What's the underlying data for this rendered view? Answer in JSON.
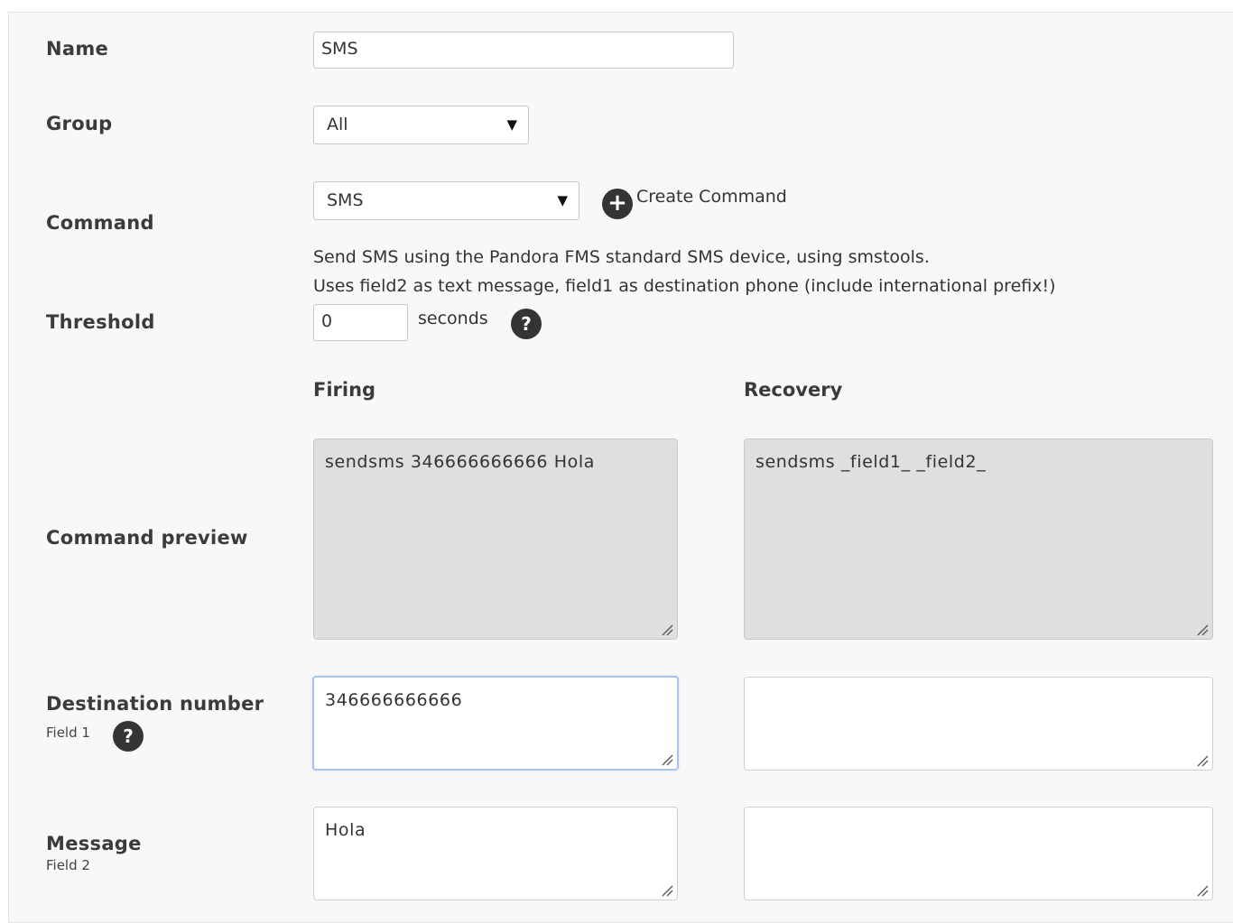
{
  "form": {
    "name": {
      "label": "Name",
      "value": "SMS"
    },
    "group": {
      "label": "Group",
      "selected": "All"
    },
    "command": {
      "label": "Command",
      "selected": "SMS",
      "create_label": "Create Command",
      "description_line1": "Send SMS using the Pandora FMS standard SMS device, using smstools.",
      "description_line2": "Uses field2 as text message, field1 as destination phone (include international prefix!)"
    },
    "threshold": {
      "label": "Threshold",
      "value": "0",
      "unit": "seconds"
    },
    "columns": {
      "firing": "Firing",
      "recovery": "Recovery"
    },
    "preview": {
      "label": "Command preview",
      "firing": "sendsms 346666666666 Hola",
      "recovery": "sendsms _field1_ _field2_"
    },
    "field1": {
      "label": "Destination number",
      "sublabel": "Field 1",
      "firing_value": "346666666666",
      "recovery_value": ""
    },
    "field2": {
      "label": "Message",
      "sublabel": "Field 2",
      "firing_value": "Hola",
      "recovery_value": ""
    }
  },
  "icons": {
    "help": "help-icon",
    "add": "plus-circle-icon",
    "dropdown": "caret-down-icon",
    "resize": "resize-grip-icon"
  },
  "glyphs": {
    "help": "?",
    "plus": "+",
    "caret": "▼"
  },
  "colors": {
    "panel_bg": "#f8f8f8",
    "readonly_bg": "#dfdfdf",
    "icon_bg": "#343434",
    "focus_border": "#a9c4ec"
  }
}
